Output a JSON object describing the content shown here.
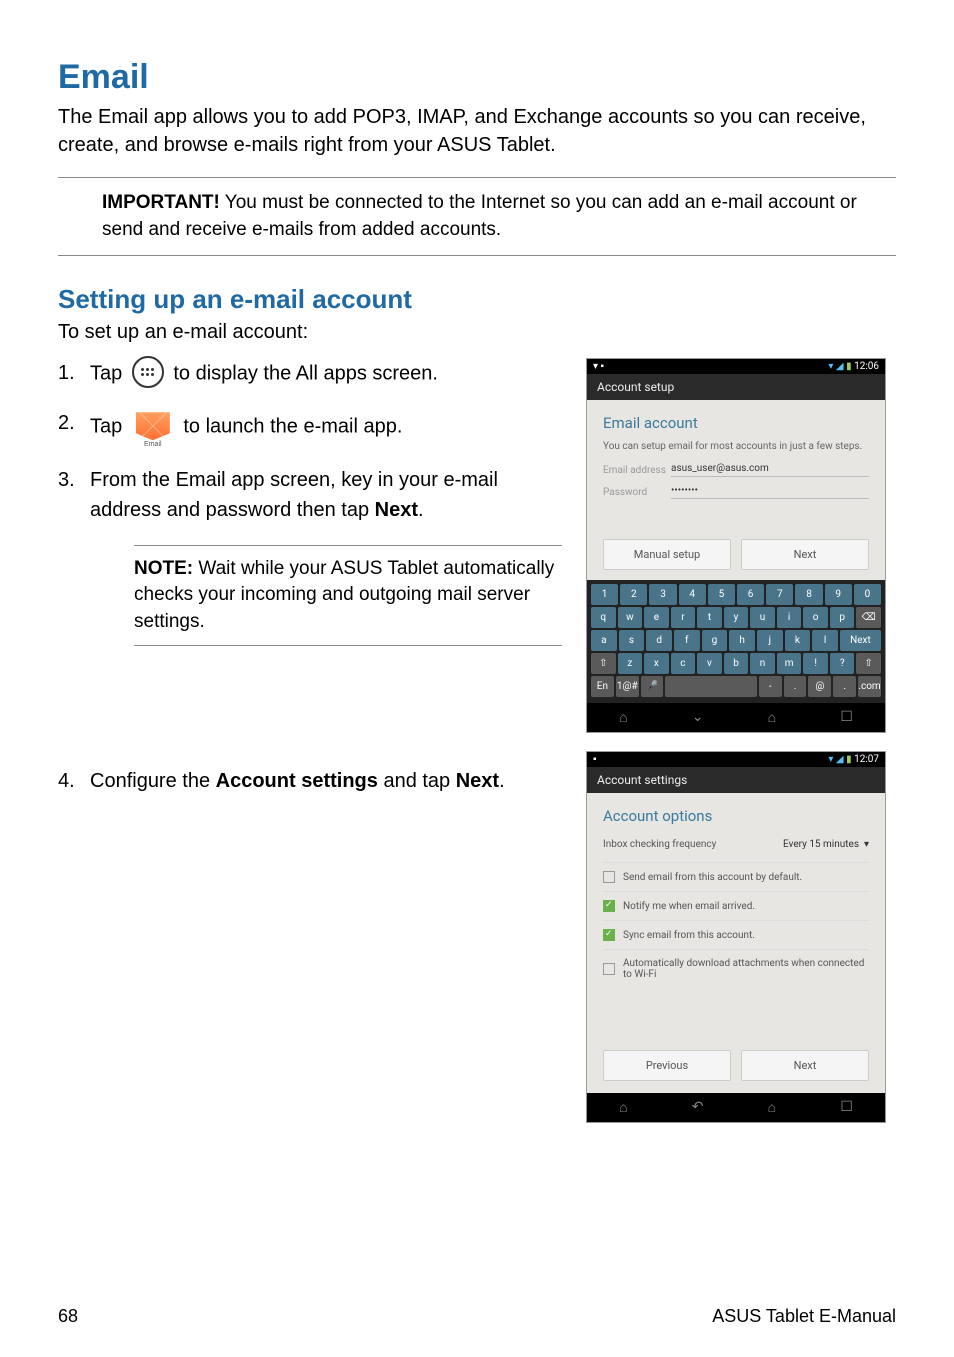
{
  "heading": "Email",
  "intro": "The Email app allows you to add POP3, IMAP, and Exchange accounts so you can receive, create, and browse e-mails right from your ASUS Tablet.",
  "important_label": "IMPORTANT!",
  "important_text": " You must be connected to the Internet so you can add an e-mail account or send and receive e-mails from added accounts.",
  "subheading": "Setting up an e-mail account",
  "subintro": "To set up an e-mail account:",
  "steps": {
    "s1": {
      "num": "1.",
      "pre": "Tap ",
      "post": " to display the All apps screen."
    },
    "s2": {
      "num": "2.",
      "pre": "Tap ",
      "post": " to launch the e-mail app.",
      "icon_label": "Email"
    },
    "s3": {
      "num": "3.",
      "text_a": "From the Email app screen, key in your e-mail address and password then tap ",
      "bold": "Next",
      "text_b": "."
    },
    "s4": {
      "num": "4.",
      "text_a": "Configure the ",
      "bold1": "Account settings",
      "text_b": " and tap ",
      "bold2": "Next",
      "text_c": "."
    }
  },
  "note_label": "NOTE:",
  "note_text": " Wait while your ASUS Tablet automatically checks your incoming and outgoing mail server settings.",
  "shot1": {
    "status_time": "12:06",
    "title": "Account setup",
    "heading": "Email account",
    "desc": "You can setup email for most accounts in just a few steps.",
    "email_lbl": "Email address",
    "email_val": "asus_user@asus.com",
    "pass_lbl": "Password",
    "pass_val": "••••••••",
    "btn_manual": "Manual setup",
    "btn_next": "Next",
    "kb_rows": [
      [
        "1",
        "2",
        "3",
        "4",
        "5",
        "6",
        "7",
        "8",
        "9",
        "0"
      ],
      [
        "q",
        "w",
        "e",
        "r",
        "t",
        "y",
        "u",
        "i",
        "o",
        "p",
        "⌫"
      ],
      [
        "a",
        "s",
        "d",
        "f",
        "g",
        "h",
        "j",
        "k",
        "l",
        "Next"
      ],
      [
        "⇧",
        "z",
        "x",
        "c",
        "v",
        "b",
        "n",
        "m",
        "!",
        "?",
        "⇧"
      ],
      [
        "En",
        "1@#",
        "🎤",
        "",
        "-",
        ".",
        "@",
        ".",
        ".com"
      ]
    ]
  },
  "shot2": {
    "status_time": "12:07",
    "title": "Account settings",
    "heading": "Account options",
    "freq_lbl": "Inbox checking frequency",
    "freq_val": "Every 15 minutes",
    "opts": [
      {
        "checked": false,
        "text": "Send email from this account by default."
      },
      {
        "checked": true,
        "text": "Notify me when email arrived."
      },
      {
        "checked": true,
        "text": "Sync email from this account."
      },
      {
        "checked": false,
        "text": "Automatically download attachments when connected to Wi-Fi"
      }
    ],
    "btn_prev": "Previous",
    "btn_next": "Next"
  },
  "footer": {
    "page": "68",
    "title": "ASUS Tablet E-Manual"
  }
}
